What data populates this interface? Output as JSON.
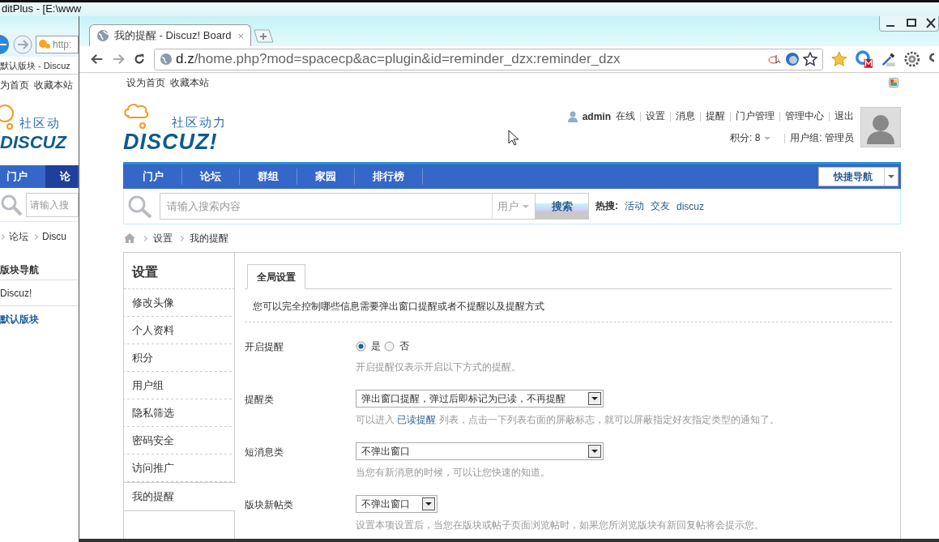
{
  "back_window": {
    "title": "ditPlus - [E:\\www",
    "address": "http:",
    "tab_title": "默认版块 - Discuz",
    "top_links": [
      "为首页",
      "收藏本站"
    ],
    "logo_tagline": "社区动",
    "logo_text": "DISCUZ",
    "nav": [
      {
        "label": "门户",
        "selected": false
      },
      {
        "label": "论",
        "selected": true
      }
    ],
    "search_placeholder": "请输入搜",
    "breadcrumb": [
      "论坛",
      "Discu"
    ],
    "sidebar": [
      {
        "label": "版块导航",
        "kind": "heading"
      },
      {
        "label": "Discuz!",
        "kind": "forum"
      },
      {
        "label": "默认版块",
        "kind": "board"
      }
    ]
  },
  "browser": {
    "tab": {
      "title": "我的提醒 - Discuz! Board",
      "close": "×"
    },
    "url": {
      "host": "d.z",
      "path": "/home.php?mod=spacecp&ac=plugin&id=reminder_dzx:reminder_dzx"
    }
  },
  "page": {
    "top_links": [
      "设为首页",
      "收藏本站"
    ],
    "logo": {
      "tagline": "社区动力",
      "text": "DISCUZ!"
    },
    "user": {
      "name": "admin",
      "status": "在线",
      "links": [
        "设置",
        "消息",
        "提醒",
        "门户管理",
        "管理中心",
        "退出"
      ],
      "credits": "积分: 8",
      "group": "用户组: 管理员"
    },
    "nav": [
      "门户",
      "论坛",
      "群组",
      "家园",
      "排行榜"
    ],
    "quick_nav": "快捷导航",
    "search": {
      "placeholder": "请输入搜索内容",
      "scope": "用户",
      "button": "搜索",
      "hot_label": "热搜:",
      "hot": [
        "活动",
        "交友",
        "discuz"
      ]
    },
    "breadcrumb": [
      "设置",
      "我的提醒"
    ],
    "sidebar": {
      "title": "设置",
      "items": [
        {
          "label": "修改头像",
          "selected": false
        },
        {
          "label": "个人资料",
          "selected": false
        },
        {
          "label": "积分",
          "selected": false
        },
        {
          "label": "用户组",
          "selected": false
        },
        {
          "label": "隐私筛选",
          "selected": false
        },
        {
          "label": "密码安全",
          "selected": false
        },
        {
          "label": "访问推广",
          "selected": false
        },
        {
          "label": "我的提醒",
          "selected": true
        }
      ]
    },
    "tabs": [
      {
        "label": "全局设置",
        "selected": true
      }
    ],
    "intro": "您可以完全控制哪些信息需要弹出窗口提醒或者不提醒以及提醒方式",
    "settings": [
      {
        "kind": "radio",
        "label": "开启提醒",
        "options": [
          {
            "label": "是",
            "selected": true
          },
          {
            "label": "否",
            "selected": false
          }
        ],
        "hint": "开启提醒仅表示开启以下方式的提醒。"
      },
      {
        "kind": "select",
        "label": "提醒类",
        "value": "弹出窗口提醒，弹过后即标记为已读，不再提醒",
        "hint": "可以进入 ",
        "hint_link": "已读提醒",
        "hint_after": " 列表，点击一下列表右面的屏蔽标志，就可以屏蔽指定好友指定类型的通知了。"
      },
      {
        "kind": "select",
        "label": "短消息类",
        "value": "不弹出窗口",
        "hint": "当您有新消息的时候，可以让您快速的知道。"
      },
      {
        "kind": "select",
        "label": "版块新帖类",
        "value": "不弹出窗口",
        "hint": "设置本项设置后，当您在版块或帖子页面浏览帖时，如果您所浏览版块有新回复帖将会提示您。"
      }
    ]
  }
}
